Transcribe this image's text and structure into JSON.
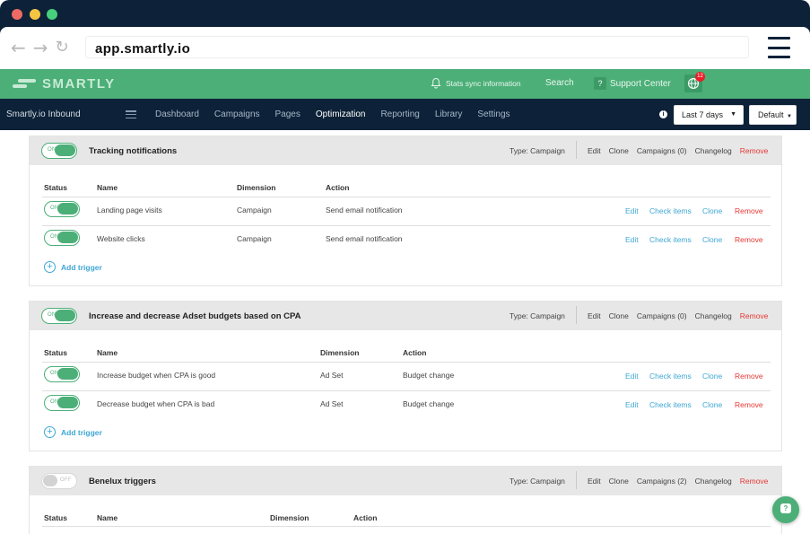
{
  "browser": {
    "url": "app.smartly.io",
    "back_glyph": "←",
    "forward_glyph": "→",
    "reload_glyph": "↻"
  },
  "topbar": {
    "logo_text": "SMARTLY",
    "stats_sync": "Stats sync information",
    "search": "Search",
    "support_icon_label": "?",
    "support": "Support Center",
    "notifications_count": "12"
  },
  "navbar": {
    "account": "Smartly.io Inbound",
    "links": [
      "Dashboard",
      "Campaigns",
      "Pages",
      "Optimization",
      "Reporting",
      "Library",
      "Settings"
    ],
    "active_link": "Optimization",
    "date_range": "Last 7 days",
    "preset": "Default"
  },
  "cards": [
    {
      "title": "Tracking notifications",
      "toggle": "ON",
      "type": "Type: Campaign",
      "actions": [
        "Edit",
        "Clone",
        "Campaigns (0)",
        "Changelog",
        "Remove"
      ],
      "columns": [
        "Status",
        "Name",
        "Dimension",
        "Action"
      ],
      "rows": [
        {
          "toggle": "ON",
          "name": "Landing page visits",
          "dimension": "Campaign",
          "action": "Send email notification"
        },
        {
          "toggle": "ON",
          "name": "Website clicks",
          "dimension": "Campaign",
          "action": "Send email notification"
        }
      ],
      "row_actions": [
        "Edit",
        "Check items",
        "Clone",
        "Remove"
      ],
      "add_trigger": "Add trigger"
    },
    {
      "title": "Increase and decrease Adset budgets based on CPA",
      "toggle": "ON",
      "type": "Type: Campaign",
      "actions": [
        "Edit",
        "Clone",
        "Campaigns (0)",
        "Changelog",
        "Remove"
      ],
      "columns": [
        "Status",
        "Name",
        "Dimension",
        "Action"
      ],
      "rows": [
        {
          "toggle": "ON",
          "name": "Increase budget when CPA is good",
          "dimension": "Ad Set",
          "action": "Budget change"
        },
        {
          "toggle": "ON",
          "name": "Decrease budget when CPA is bad",
          "dimension": "Ad Set",
          "action": "Budget change"
        }
      ],
      "row_actions": [
        "Edit",
        "Check items",
        "Clone",
        "Remove"
      ],
      "add_trigger": "Add trigger"
    },
    {
      "title": "Benelux triggers",
      "toggle": "OFF",
      "type": "Type: Campaign",
      "actions": [
        "Edit",
        "Clone",
        "Campaigns (2)",
        "Changelog",
        "Remove"
      ],
      "columns": [
        "Status",
        "Name",
        "Dimension",
        "Action"
      ]
    }
  ],
  "chat_icon_label": "?",
  "colors": {
    "brand_green": "#4caf78",
    "navy": "#0d2238",
    "link_blue": "#3ea7d4",
    "remove_red": "#e53935"
  }
}
